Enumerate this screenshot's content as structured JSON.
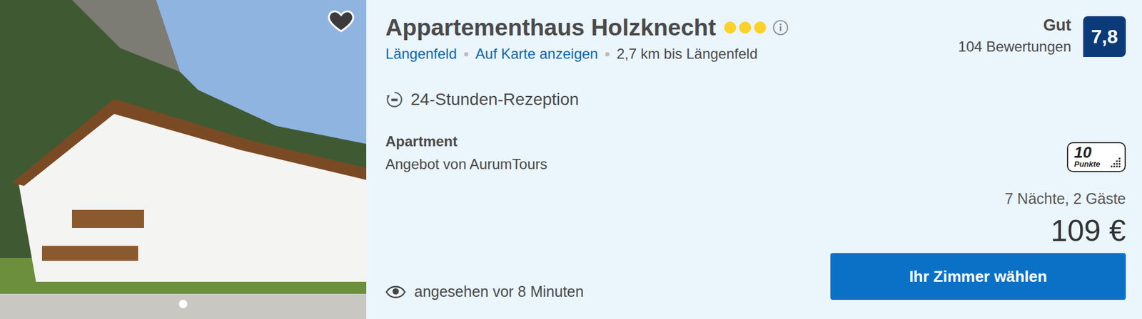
{
  "listing": {
    "title": "Appartementhaus Holzknecht",
    "stars": 3,
    "location_link": "Längenfeld",
    "map_link": "Auf Karte anzeigen",
    "distance": "2,7 km bis Längenfeld",
    "feature": "24-Stunden-Rezeption",
    "room_type": "Apartment",
    "offer": "Angebot von AurumTours",
    "viewed": "angesehen vor 8 Minuten"
  },
  "rating": {
    "label": "Gut",
    "reviews": "104 Bewertungen",
    "score": "7,8"
  },
  "points": {
    "value": "10",
    "label": "Punkte"
  },
  "price": {
    "stay": "7 Nächte, 2 Gäste",
    "amount": "109 €"
  },
  "carousel": [
    {
      "selected": true
    }
  ],
  "buttons": [
    "Ihr Zimmer wählen"
  ]
}
